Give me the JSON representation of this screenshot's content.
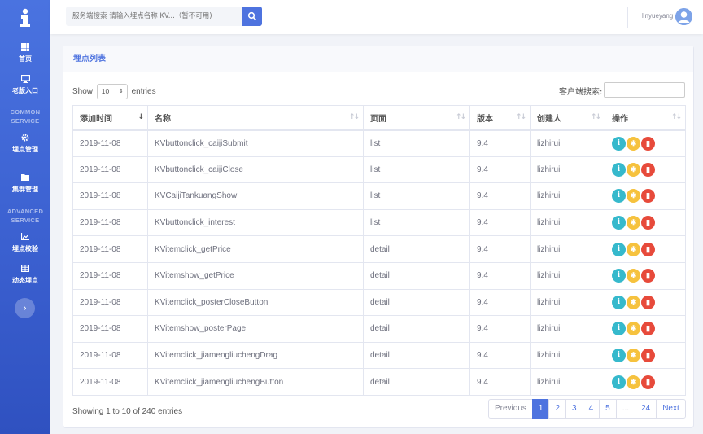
{
  "sidebar": {
    "logo": "i",
    "items": [
      {
        "label": "首页",
        "icon": "grid-icon"
      },
      {
        "label": "老版入口",
        "icon": "monitor-icon"
      },
      {
        "label": "埋点管理",
        "icon": "gear-icon"
      },
      {
        "label": "集群管理",
        "icon": "folder-icon"
      },
      {
        "label": "埋点校验",
        "icon": "chart-icon"
      },
      {
        "label": "动态埋点",
        "icon": "table-icon"
      }
    ],
    "sections": [
      "COMMON",
      "SERVICE",
      "ADVANCED",
      "SERVICE"
    ],
    "collapse_label": "›"
  },
  "topbar": {
    "search_placeholder": "服务端搜索 请输入埋点名称 KV...（暂不可用)",
    "username": "linyueyang"
  },
  "card": {
    "title": "埋点列表",
    "show_prefix": "Show",
    "show_value": "10",
    "show_suffix": "entries",
    "filter_label": "客户端搜索:",
    "columns": [
      "添加时间",
      "名称",
      "页面",
      "版本",
      "创建人",
      "操作"
    ],
    "rows": [
      [
        "2019-11-08",
        "KVbuttonclick_caijiSubmit",
        "list",
        "9.4",
        "lizhirui"
      ],
      [
        "2019-11-08",
        "KVbuttonclick_caijiClose",
        "list",
        "9.4",
        "lizhirui"
      ],
      [
        "2019-11-08",
        "KVCaijiTankuangShow",
        "list",
        "9.4",
        "lizhirui"
      ],
      [
        "2019-11-08",
        "KVbuttonclick_interest",
        "list",
        "9.4",
        "lizhirui"
      ],
      [
        "2019-11-08",
        "KVitemclick_getPrice",
        "detail",
        "9.4",
        "lizhirui"
      ],
      [
        "2019-11-08",
        "KVitemshow_getPrice",
        "detail",
        "9.4",
        "lizhirui"
      ],
      [
        "2019-11-08",
        "KVitemclick_posterCloseButton",
        "detail",
        "9.4",
        "lizhirui"
      ],
      [
        "2019-11-08",
        "KVitemshow_posterPage",
        "detail",
        "9.4",
        "lizhirui"
      ],
      [
        "2019-11-08",
        "KVitemclick_jiamengliuchengDrag",
        "detail",
        "9.4",
        "lizhirui"
      ],
      [
        "2019-11-08",
        "KVitemclick_jiamengliuchengButton",
        "detail",
        "9.4",
        "lizhirui"
      ]
    ],
    "row_actions": {
      "info": "i",
      "config": "✱",
      "delete": "▮"
    },
    "info_text": "Showing 1 to 10 of 240 entries",
    "pagination": [
      "Previous",
      "1",
      "2",
      "3",
      "4",
      "5",
      "...",
      "24",
      "Next"
    ]
  },
  "colors": {
    "primary": "#4e73df",
    "info": "#36b9cc",
    "warning": "#f6c23e",
    "danger": "#e74a3b"
  }
}
